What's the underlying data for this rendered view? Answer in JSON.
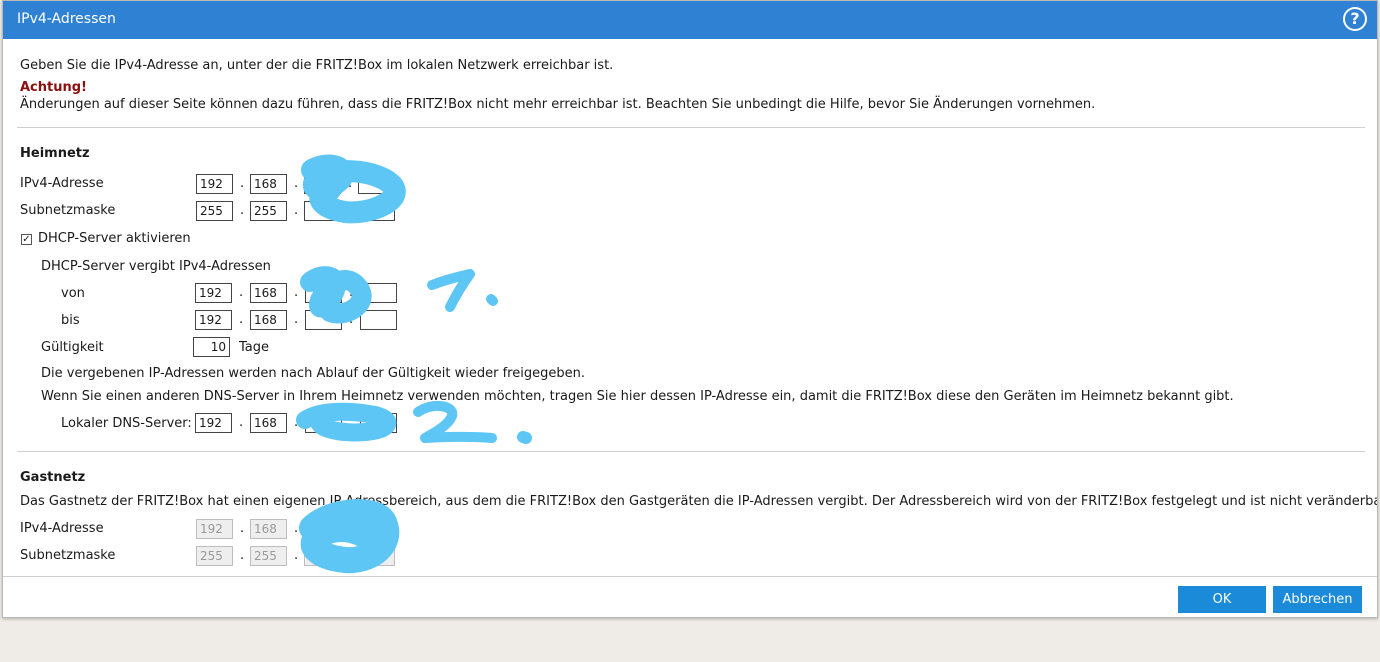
{
  "dialog": {
    "title": "IPv4-Adressen",
    "help_label": "?"
  },
  "intro": {
    "line1": "Geben Sie die IPv4-Adresse an, unter der die FRITZ!Box im lokalen Netzwerk erreichbar ist.",
    "warning_label": "Achtung!",
    "warning_text": "Änderungen auf dieser Seite können dazu führen, dass die FRITZ!Box nicht mehr erreichbar ist. Beachten Sie unbedingt die Hilfe, bevor Sie Änderungen vornehmen."
  },
  "heimnetz": {
    "heading": "Heimnetz",
    "ipv4_label": "IPv4-Adresse",
    "ipv4": [
      "192",
      "168",
      "",
      ""
    ],
    "subnet_label": "Subnetzmaske",
    "subnet": [
      "255",
      "255",
      "",
      ""
    ],
    "dhcp_checkbox_label": "DHCP-Server aktivieren",
    "dhcp_checked": true,
    "dhcp_range_label": "DHCP-Server vergibt IPv4-Adressen",
    "von_label": "von",
    "von": [
      "192",
      "168",
      "",
      ""
    ],
    "bis_label": "bis",
    "bis": [
      "192",
      "168",
      "",
      ""
    ],
    "validity_label": "Gültigkeit",
    "validity_value": "10",
    "validity_unit": "Tage",
    "info1": "Die vergebenen IP-Adressen werden nach Ablauf der Gültigkeit wieder freigegeben.",
    "info2": "Wenn Sie einen anderen DNS-Server in Ihrem Heimnetz verwenden möchten, tragen Sie hier dessen IP-Adresse ein, damit die FRITZ!Box diese den Geräten im Heimnetz bekannt gibt.",
    "dns_label": "Lokaler DNS-Server:",
    "dns": [
      "192",
      "168",
      "",
      ""
    ]
  },
  "gastnetz": {
    "heading": "Gastnetz",
    "description": "Das Gastnetz der FRITZ!Box hat einen eigenen IP-Adressbereich, aus dem die FRITZ!Box den Gastgeräten die IP-Adressen vergibt. Der Adressbereich wird von der FRITZ!Box festgelegt und ist nicht veränderbar.",
    "ipv4_label": "IPv4-Adresse",
    "ipv4": [
      "192",
      "168",
      "",
      ""
    ],
    "subnet_label": "Subnetzmaske",
    "subnet": [
      "255",
      "255",
      "",
      ""
    ]
  },
  "footer": {
    "ok_label": "OK",
    "cancel_label": "Abbrechen"
  },
  "colors": {
    "titlebar": "#2f82d3",
    "button": "#1a8ad9",
    "warning": "#8b0f0f",
    "scribble": "#5ec6f5"
  }
}
